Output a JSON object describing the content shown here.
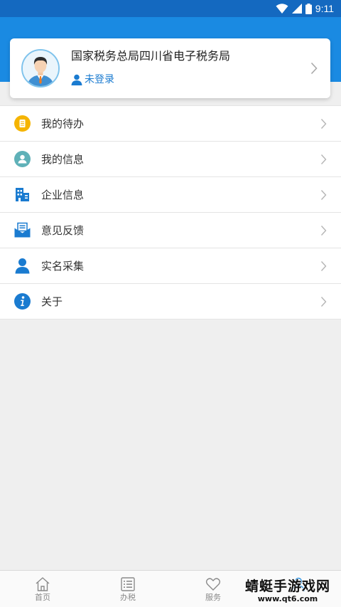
{
  "status_bar": {
    "time": "9:11",
    "icons": [
      "wifi-icon",
      "signal-icon",
      "battery-icon"
    ]
  },
  "profile": {
    "org_name": "国家税务总局四川省电子税务局",
    "login_status": "未登录"
  },
  "menu": [
    {
      "label": "我的待办",
      "icon": "todo-icon",
      "color": "#f5b400"
    },
    {
      "label": "我的信息",
      "icon": "person-circle-icon",
      "color": "#5fb1b8"
    },
    {
      "label": "企业信息",
      "icon": "building-icon",
      "color": "#1a7bd0"
    },
    {
      "label": "意见反馈",
      "icon": "feedback-mail-icon",
      "color": "#1a7bd0"
    },
    {
      "label": "实名采集",
      "icon": "person-icon",
      "color": "#1a7bd0"
    },
    {
      "label": "关于",
      "icon": "info-icon",
      "color": "#1a7bd0"
    }
  ],
  "tabs": [
    {
      "label": "首页",
      "icon": "home-icon"
    },
    {
      "label": "办税",
      "icon": "list-icon"
    },
    {
      "label": "服务",
      "icon": "heart-icon"
    },
    {
      "label": "",
      "icon": "user-icon"
    }
  ],
  "watermark": {
    "main": "蜻蜓手游戏网",
    "sub": "www.qt6.com"
  },
  "colors": {
    "status_bar": "#1469c0",
    "header": "#1a8ae2",
    "accent": "#1a7bd0",
    "background": "#efefef"
  }
}
